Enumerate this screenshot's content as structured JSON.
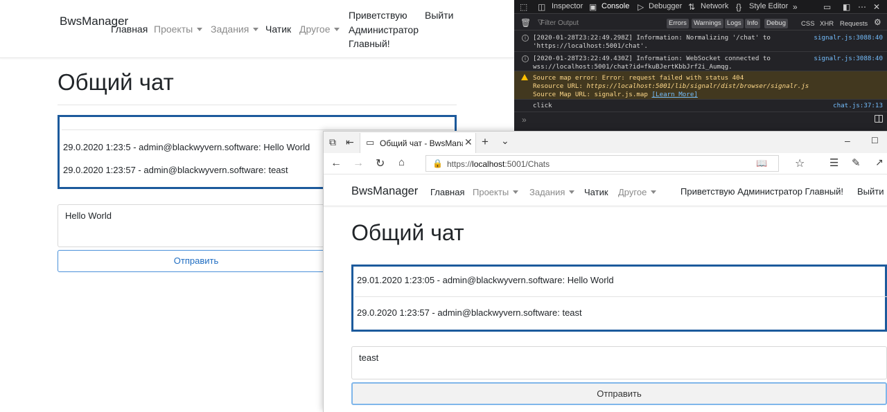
{
  "bg_page": {
    "brand": "BwsManager",
    "nav": {
      "home": "Главная",
      "projects": "Проекты",
      "tasks": "Задания",
      "chat": "Чатик",
      "other": "Другое"
    },
    "greeting": "Приветствую Администратор Главный!",
    "logout": "Выйти",
    "title": "Общий чат",
    "messages": [
      "29.0.2020 1:23:5 - admin@blackwyvern.software: Hello World",
      "29.0.2020 1:23:57 - admin@blackwyvern.software: teast"
    ],
    "input_value": "Hello World",
    "send_label": "Отправить"
  },
  "devtools": {
    "tabs": {
      "inspector": "Inspector",
      "console": "Console",
      "debugger": "Debugger",
      "network": "Network",
      "style_editor": "Style Editor"
    },
    "filter_placeholder": "Filter Output",
    "filters": {
      "errors": "Errors",
      "warnings": "Warnings",
      "logs": "Logs",
      "info": "Info",
      "debug": "Debug",
      "css": "CSS",
      "xhr": "XHR",
      "requests": "Requests"
    },
    "log_rows": [
      {
        "line1": "[2020-01-28T23:22:49.298Z] Information: Normalizing '/chat' to",
        "line2": "'https://localhost:5001/chat'.",
        "source": "signalr.js:3088:40"
      },
      {
        "line1": "[2020-01-28T23:22:49.430Z] Information: WebSocket connected to",
        "line2": "wss://localhost:5001/chat?id=fkuBJertKbbJrf2i_Aumqg.",
        "source": "signalr.js:3088:40"
      }
    ],
    "warning": {
      "line1": "Source map error: Error: request failed with status 404",
      "line2_label": "Resource URL:",
      "line2_value": "https://localhost:5001/lib/signalr/dist/browser/signalr.js",
      "line3_label": "Source Map URL: signalr.js.map",
      "learn_more": "[Learn More]"
    },
    "click_row": {
      "text": "click",
      "source": "chat.js:37:13"
    },
    "prompt": "»"
  },
  "fg_window": {
    "tab_title": "Общий чат - BwsManag",
    "url_prefix": "https://",
    "url_host": "localhost",
    "url_rest": ":5001/Chats",
    "brand": "BwsManager",
    "nav": {
      "home": "Главная",
      "projects": "Проекты",
      "tasks": "Задания",
      "chat": "Чатик",
      "other": "Другое"
    },
    "greeting": "Приветствую Администратор Главный!",
    "logout": "Выйти",
    "title": "Общий чат",
    "messages": [
      "29.01.2020 1:23:05 - admin@blackwyvern.software: Hello World",
      "29.0.2020 1:23:57 - admin@blackwyvern.software: teast"
    ],
    "input_value": "teast",
    "send_label": "Отправить"
  },
  "colors": {
    "chat_border": "#1c5a9c",
    "link_blue": "#1f6dc2",
    "devtools_bg": "#232327",
    "warning_bg": "#42381f"
  }
}
